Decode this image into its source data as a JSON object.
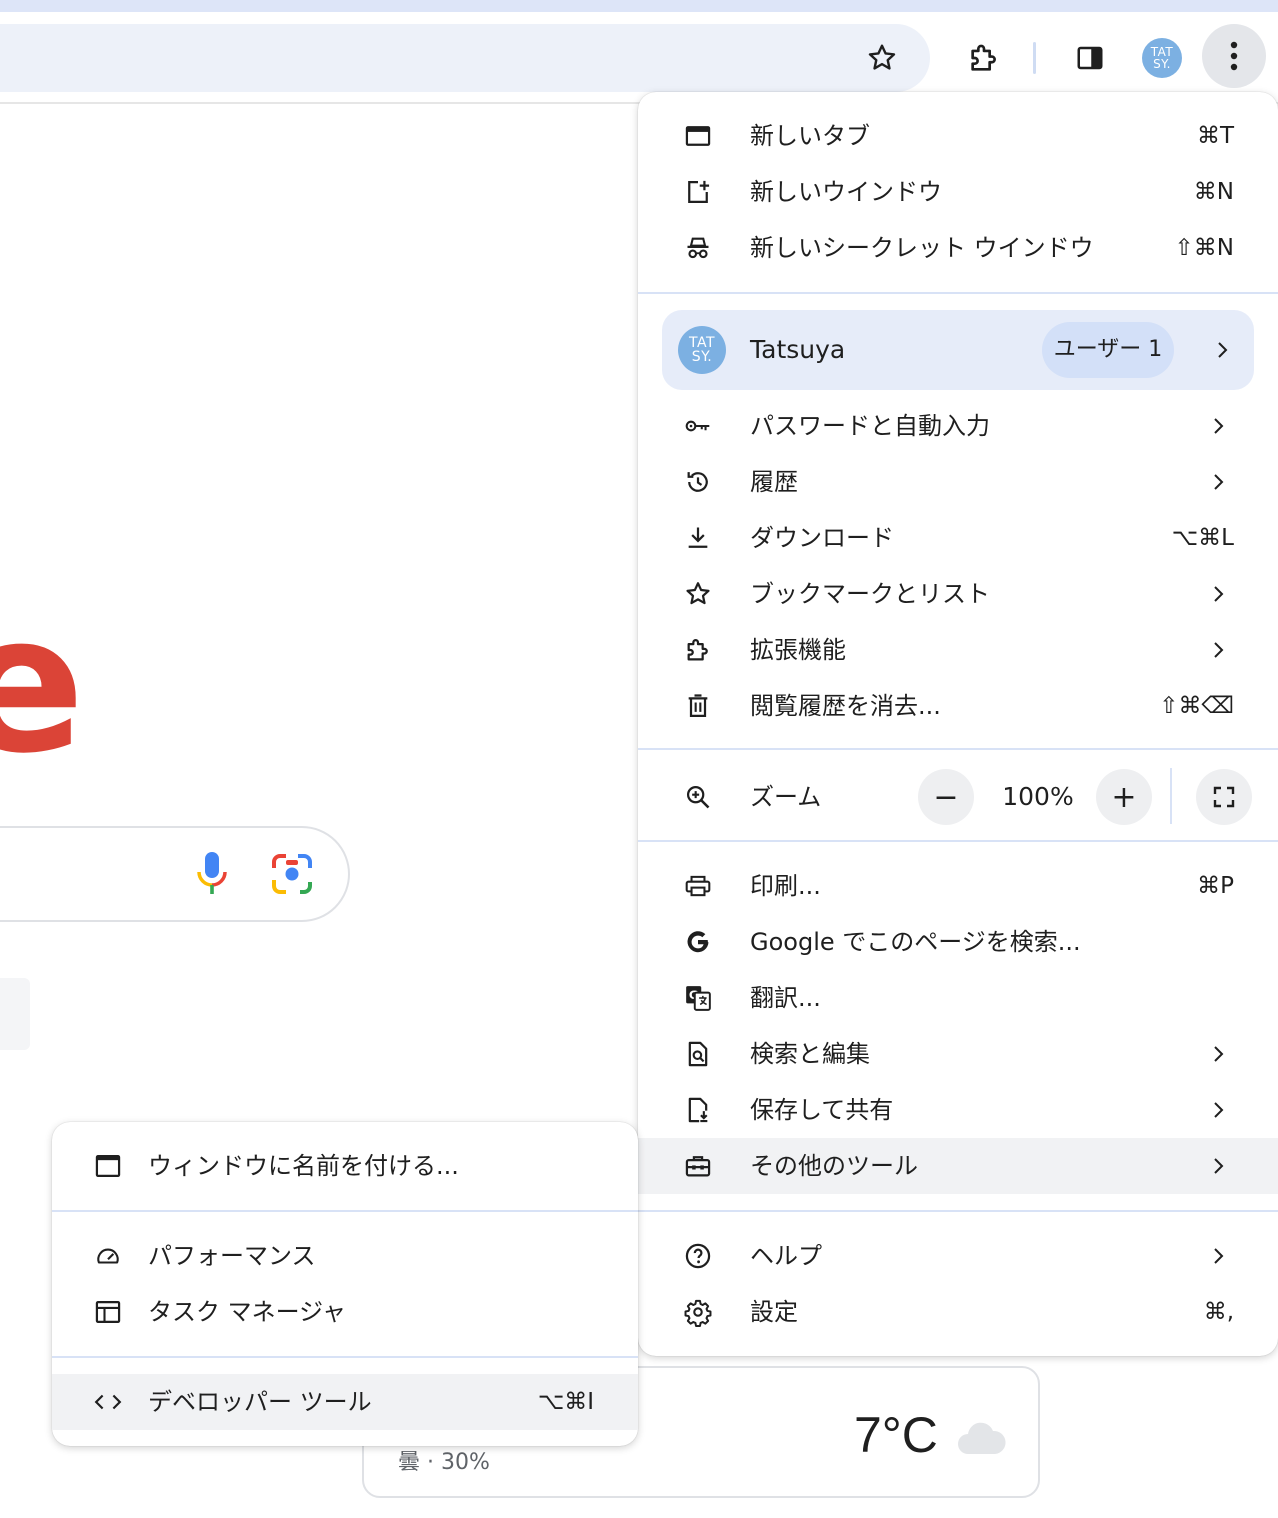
{
  "toolbar": {
    "avatar_text": "TAT\nSY.",
    "icons": [
      "bookmark-star-icon",
      "extensions-icon",
      "side-panel-icon",
      "profile-avatar",
      "more-vert-icon"
    ]
  },
  "page": {
    "logo_letter": "e",
    "weather": {
      "temp": "7°C",
      "desc": "曇 · 30%"
    }
  },
  "menu": {
    "new_tab": {
      "label": "新しいタブ",
      "shortcut": "⌘T"
    },
    "new_window": {
      "label": "新しいウインドウ",
      "shortcut": "⌘N"
    },
    "new_incognito": {
      "label": "新しいシークレット ウインドウ",
      "shortcut": "⇧⌘N"
    },
    "profile": {
      "avatar_text": "TAT\nSY.",
      "name": "Tatsuya",
      "badge": "ユーザー 1"
    },
    "passwords": {
      "label": "パスワードと自動入力"
    },
    "history": {
      "label": "履歴"
    },
    "downloads": {
      "label": "ダウンロード",
      "shortcut": "⌥⌘L"
    },
    "bookmarks": {
      "label": "ブックマークとリスト"
    },
    "extensions": {
      "label": "拡張機能"
    },
    "clear_data": {
      "label": "閲覧履歴を消去...",
      "shortcut": "⇧⌘⌫"
    },
    "zoom": {
      "label": "ズーム",
      "minus": "−",
      "value": "100%",
      "plus": "+"
    },
    "print": {
      "label": "印刷...",
      "shortcut": "⌘P"
    },
    "google_search": {
      "label": "Google でこのページを検索..."
    },
    "translate": {
      "label": "翻訳..."
    },
    "find_edit": {
      "label": "検索と編集"
    },
    "save_share": {
      "label": "保存して共有"
    },
    "more_tools": {
      "label": "その他のツール"
    },
    "help": {
      "label": "ヘルプ"
    },
    "settings": {
      "label": "設定",
      "shortcut": "⌘,"
    }
  },
  "submenu": {
    "name_window": {
      "label": "ウィンドウに名前を付ける..."
    },
    "performance": {
      "label": "パフォーマンス"
    },
    "task_manager": {
      "label": "タスク マネージャ"
    },
    "devtools": {
      "label": "デベロッパー ツール",
      "shortcut": "⌥⌘I"
    }
  }
}
